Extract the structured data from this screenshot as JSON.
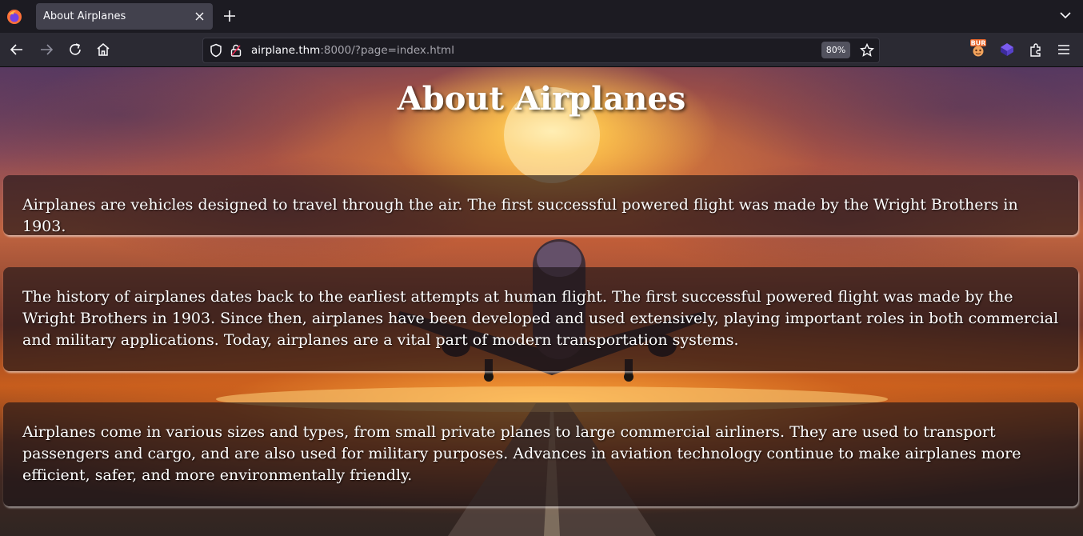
{
  "browser": {
    "tab_title": "About Airplanes",
    "url_host": "airplane.thm",
    "url_rest": ":8000/?page=index.html",
    "zoom": "80%",
    "icons": [
      "firefox-logo-icon",
      "close-icon",
      "plus-icon",
      "chevron-down-icon",
      "back-arrow-icon",
      "forward-arrow-icon",
      "reload-icon",
      "home-icon",
      "shield-icon",
      "lock-icon",
      "star-icon",
      "burp-extension-icon",
      "cube-extension-icon",
      "extensions-puzzle-icon",
      "hamburger-menu-icon"
    ]
  },
  "page": {
    "title": "About Airplanes",
    "paragraphs": [
      "Airplanes are vehicles designed to travel through the air. The first successful powered flight was made by the Wright Brothers in 1903.",
      "The history of airplanes dates back to the earliest attempts at human flight. The first successful powered flight was made by the Wright Brothers in 1903. Since then, airplanes have been developed and used extensively, playing important roles in both commercial and military applications. Today, airplanes are a vital part of modern transportation systems.",
      "Airplanes come in various sizes and types, from small private planes to large commercial airliners. They are used to transport passengers and cargo, and are also used for military purposes. Advances in aviation technology continue to make airplanes more efficient, safer, and more environmentally friendly."
    ]
  },
  "colors": {
    "chrome_dark": "#1c1b22",
    "toolbar": "#2b2a33",
    "active_tab": "#42414d",
    "card_bg": "rgba(30,22,25,0.66)"
  }
}
